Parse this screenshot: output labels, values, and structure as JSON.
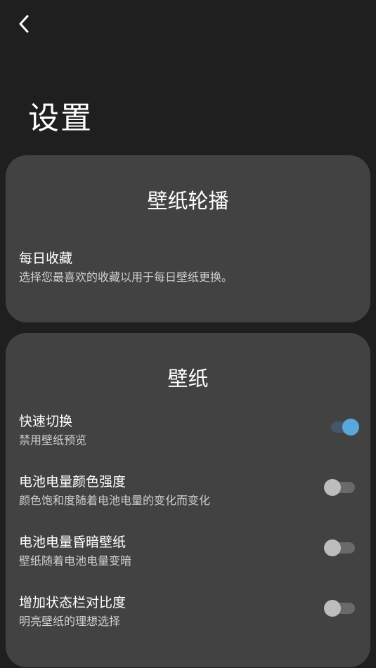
{
  "header": {
    "back_icon": "chevron-left-icon",
    "title": "设置"
  },
  "wallpaper_carousel": {
    "title": "壁纸轮播",
    "items": [
      {
        "title": "每日收藏",
        "subtitle": "选择您最喜欢的收藏以用于每日壁纸更换。"
      }
    ]
  },
  "wallpaper": {
    "title": "壁纸",
    "items": [
      {
        "title": "快速切换",
        "subtitle": "禁用壁纸预览",
        "enabled": true
      },
      {
        "title": "电池电量颜色强度",
        "subtitle": "颜色饱和度随着电池电量的变化而变化",
        "enabled": false
      },
      {
        "title": "电池电量昏暗壁纸",
        "subtitle": "壁纸随着电池电量变暗",
        "enabled": false
      },
      {
        "title": "增加状态栏对比度",
        "subtitle": "明亮壁纸的理想选择",
        "enabled": false
      }
    ]
  },
  "colors": {
    "background": "#1f1f1f",
    "card": "#424242",
    "toggle_on": "#5aa7dc",
    "toggle_off": "#bdbdbd"
  }
}
